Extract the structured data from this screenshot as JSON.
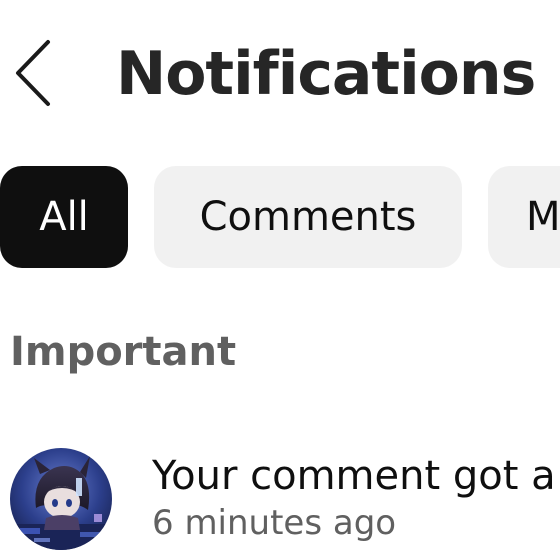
{
  "header": {
    "back_icon": "chevron-left-icon",
    "title": "Notifications"
  },
  "tabs": [
    {
      "label": "All",
      "selected": true
    },
    {
      "label": "Comments",
      "selected": false
    },
    {
      "label": "M",
      "selected": false
    }
  ],
  "sections": [
    {
      "heading": "Important",
      "notifications": [
        {
          "avatar_icon": "user-avatar",
          "text": "Your comment got a",
          "time": "6 minutes ago"
        }
      ]
    }
  ],
  "colors": {
    "tab_active_bg": "#0f0f0f",
    "tab_inactive_bg": "#f1f1f1",
    "secondary_text": "#606060"
  }
}
